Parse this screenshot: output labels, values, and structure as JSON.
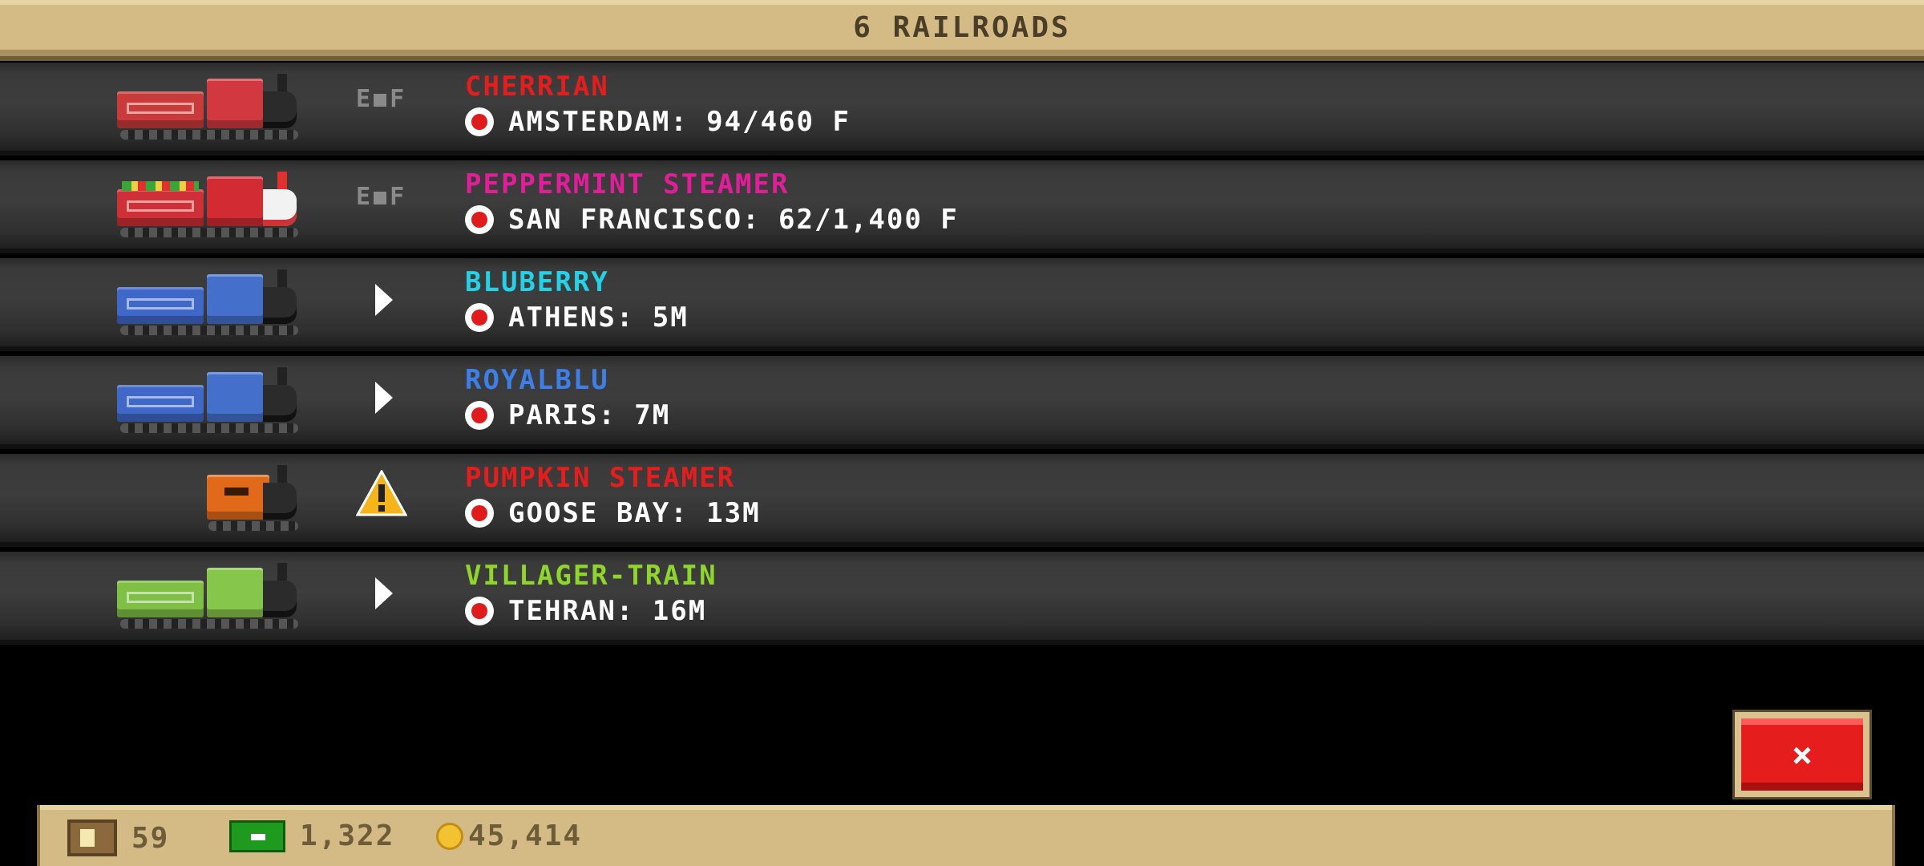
{
  "header": {
    "title": "6 RAILROADS"
  },
  "colors": {
    "red": "#e51d1d",
    "pink": "#e21d9a",
    "cyan": "#22d3e8",
    "blue": "#3d7fe8",
    "green": "#8fd62b"
  },
  "railroads": [
    {
      "name": "CHERRIAN",
      "name_color": "#e51d1d",
      "destination": "AMSTERDAM: 94/460 F",
      "status": "fuel-gauge",
      "status_text": {
        "e": "E",
        "f": "F"
      }
    },
    {
      "name": "PEPPERMINT STEAMER",
      "name_color": "#e21d9a",
      "destination": "SAN FRANCISCO: 62/1,400 F",
      "status": "fuel-gauge",
      "status_text": {
        "e": "E",
        "f": "F"
      }
    },
    {
      "name": "BLUBERRY",
      "name_color": "#22d3e8",
      "destination": "ATHENS: 5M",
      "status": "play-arrow"
    },
    {
      "name": "ROYALBLU",
      "name_color": "#3d7fe8",
      "destination": "PARIS: 7M",
      "status": "play-arrow"
    },
    {
      "name": "PUMPKIN STEAMER",
      "name_color": "#e51d1d",
      "destination": "GOOSE BAY: 13M",
      "status": "warning"
    },
    {
      "name": "VILLAGER-TRAIN",
      "name_color": "#8fd62b",
      "destination": "TEHRAN: 16M",
      "status": "play-arrow"
    }
  ],
  "close_button": {
    "label": "×"
  },
  "footer": {
    "crates": "59",
    "cash": "1,322",
    "coins": "45,414"
  }
}
